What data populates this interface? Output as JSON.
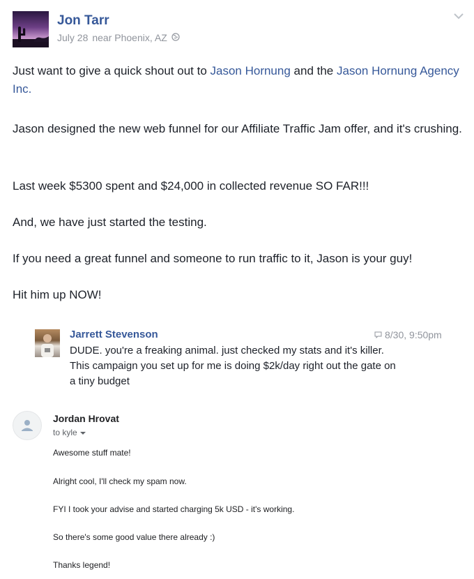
{
  "post": {
    "author": "Jon Tarr",
    "date": "July 28",
    "location_text": "near Phoenix, AZ",
    "privacy_icon": "globe-icon",
    "paragraph_1_text_a": "Just want to give a quick shout out to ",
    "paragraph_1_link_a": "Jason Hornung",
    "paragraph_1_text_b": " and the ",
    "paragraph_1_link_b": "Jason Hornung Agency Inc.",
    "paragraph_2": "Jason designed the new web funnel for our Affiliate Traffic Jam offer, and it's crushing.",
    "paragraph_3": "Last week $5300 spent and $24,000 in collected revenue SO FAR!!!",
    "paragraph_4": "And, we have just started the testing.",
    "paragraph_5": "If you need a great funnel and someone to run traffic to it, Jason is your guy!",
    "paragraph_6": "Hit him up NOW!"
  },
  "comment": {
    "author": "Jarrett Stevenson",
    "timestamp": "8/30, 9:50pm",
    "text": "DUDE. you're a freaking animal. just checked my stats and it's killer. This campaign you set up for me is doing $2k/day right out the gate on a tiny budget"
  },
  "email": {
    "sender": "Jordan Hrovat",
    "to_line": "to kyle",
    "lines": [
      "Awesome stuff mate!",
      "Alright cool, I'll check my spam now.",
      "FYI I took your advise and started charging 5k USD - it's working.",
      "So there's some good value there already :)",
      "Thanks legend!"
    ]
  },
  "colors": {
    "link": "#365899",
    "text": "#1d2129",
    "muted": "#90949c"
  }
}
